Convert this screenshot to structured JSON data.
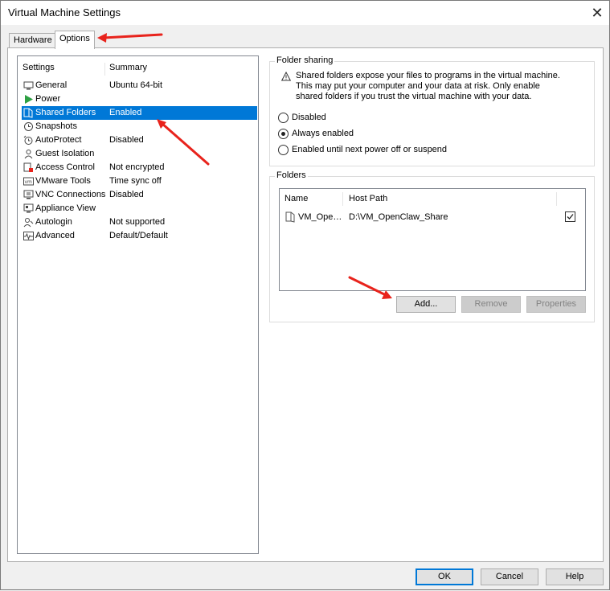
{
  "window": {
    "title": "Virtual Machine Settings",
    "close_glyph": "✕"
  },
  "tabs": [
    {
      "label": "Hardware",
      "active": false
    },
    {
      "label": "Options",
      "active": true
    }
  ],
  "settings": {
    "headers": {
      "settings": "Settings",
      "summary": "Summary"
    },
    "items": [
      {
        "label": "General",
        "summary": "Ubuntu 64-bit",
        "icon": "general-icon"
      },
      {
        "label": "Power",
        "summary": "",
        "icon": "power-icon"
      },
      {
        "label": "Shared Folders",
        "summary": "Enabled",
        "icon": "shared-folders-icon",
        "selected": true
      },
      {
        "label": "Snapshots",
        "summary": "",
        "icon": "snapshots-icon"
      },
      {
        "label": "AutoProtect",
        "summary": "Disabled",
        "icon": "autoprotect-icon"
      },
      {
        "label": "Guest Isolation",
        "summary": "",
        "icon": "guest-isolation-icon"
      },
      {
        "label": "Access Control",
        "summary": "Not encrypted",
        "icon": "access-control-icon"
      },
      {
        "label": "VMware Tools",
        "summary": "Time sync off",
        "icon": "vmware-tools-icon"
      },
      {
        "label": "VNC Connections",
        "summary": "Disabled",
        "icon": "vnc-icon"
      },
      {
        "label": "Appliance View",
        "summary": "",
        "icon": "appliance-view-icon"
      },
      {
        "label": "Autologin",
        "summary": "Not supported",
        "icon": "autologin-icon"
      },
      {
        "label": "Advanced",
        "summary": "Default/Default",
        "icon": "advanced-icon"
      }
    ]
  },
  "folder_sharing": {
    "title": "Folder sharing",
    "warning_lines": [
      "Shared folders expose your files to programs in the virtual machine.",
      "This may put your computer and your data at risk. Only enable",
      "shared folders if you trust the virtual machine with your data."
    ],
    "options": [
      {
        "label": "Disabled",
        "checked": false
      },
      {
        "label": "Always enabled",
        "checked": true
      },
      {
        "label": "Enabled until next power off or suspend",
        "checked": false
      }
    ]
  },
  "folders": {
    "title": "Folders",
    "columns": {
      "name": "Name",
      "host_path": "Host Path"
    },
    "rows": [
      {
        "name": "VM_Ope…",
        "host_path": "D:\\VM_OpenClaw_Share",
        "enabled": true
      }
    ],
    "buttons": {
      "add": "Add...",
      "remove": "Remove",
      "properties": "Properties"
    }
  },
  "footer": {
    "ok": "OK",
    "cancel": "Cancel",
    "help": "Help"
  },
  "colors": {
    "selection": "#0078d7",
    "annotation_arrow": "#e8231c",
    "power_icon": "#2ea043"
  }
}
